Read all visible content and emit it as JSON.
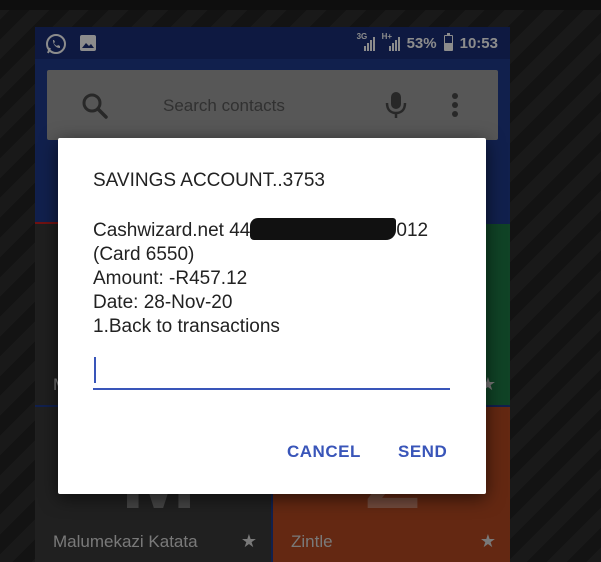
{
  "status_bar": {
    "network_tag_1": "3G",
    "network_tag_2": "H+",
    "battery": "53%",
    "battery_level": 0.53,
    "time": "10:53",
    "icons": [
      "whatsapp-icon",
      "image-icon",
      "signal-icon",
      "battery-icon"
    ]
  },
  "search": {
    "placeholder": "Search contacts",
    "icons": [
      "search-icon",
      "mic-icon",
      "more-vert-icon"
    ]
  },
  "tiles": [
    {
      "initial": "M",
      "name": "M",
      "color": "#3a3a3a"
    },
    {
      "initial": "",
      "name": "",
      "color": "#1e7a46"
    },
    {
      "initial": "M",
      "name": "Malumekazi Katata",
      "color": "#3b3b3b"
    },
    {
      "initial": "Z",
      "name": "Zintle",
      "color": "#b64a22"
    }
  ],
  "dialog": {
    "title": "SAVINGS ACCOUNT..3753",
    "merchant_prefix": "Cashwizard.net 44",
    "merchant_suffix": "012 (Card 6550)",
    "amount": "Amount: -R457.12",
    "date": "Date: 28-Nov-20",
    "option": "1.Back to transactions",
    "input_value": "",
    "cancel_label": "CANCEL",
    "send_label": "SEND"
  },
  "colors": {
    "accent": "#3955b9",
    "app_bar": "#1f3b8c",
    "status_bar": "#1a2f77"
  }
}
